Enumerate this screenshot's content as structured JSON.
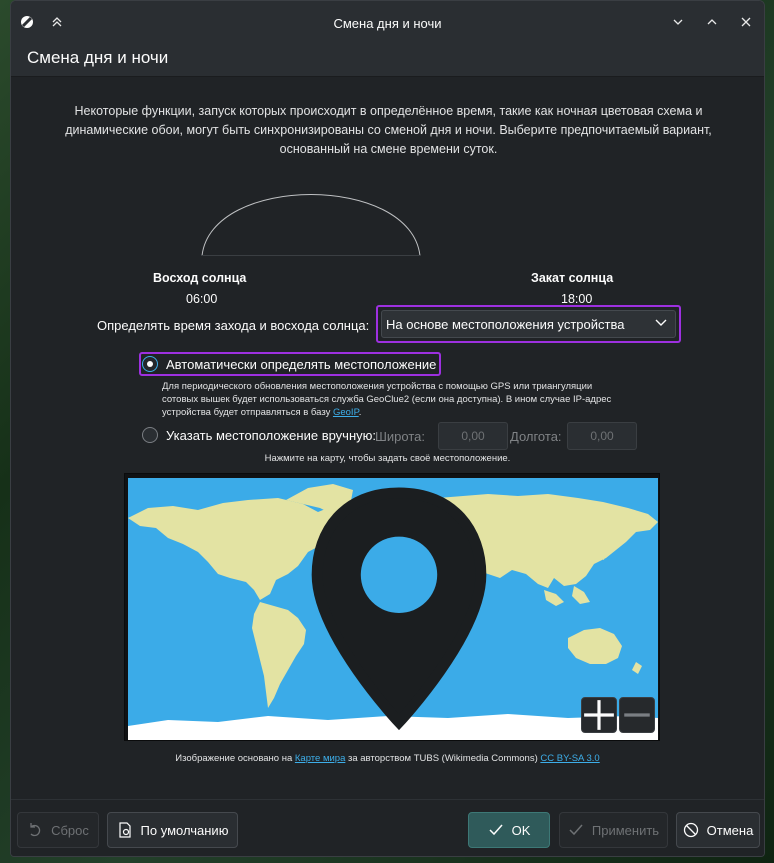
{
  "window": {
    "title": "Смена дня и ночи"
  },
  "header": {
    "title": "Смена дня и ночи"
  },
  "description": {
    "line1": "Некоторые функции, запуск которых происходит в определённое время, такие как ночная цветовая схема и",
    "line2": "динамические обои, могут быть синхронизированы со сменой дня и ночи. Выберите предпочитаемый вариант,",
    "line3": "основанный на смене времени суток."
  },
  "sunrise": {
    "label": "Восход солнца",
    "time": "06:00"
  },
  "sunset": {
    "label": "Закат солнца",
    "time": "18:00"
  },
  "mode": {
    "label": "Определять время захода и восхода солнца:",
    "selected": "На основе местоположения устройства"
  },
  "auto_location": {
    "label": "Автоматически определять местоположение",
    "checked": true,
    "help_line1": "Для периодического обновления местоположения устройства с помощью GPS или триангуляции",
    "help_line2": "сотовых вышек будет использоваться служба GeoClue2 (если она доступна). В ином случае IP-адрес",
    "help_line3_prefix": "устройства будет отправляться в базу ",
    "help_link": "GeoIP",
    "help_line3_suffix": "."
  },
  "manual_location": {
    "label": "Указать местоположение вручную:",
    "checked": false,
    "latitude_label": "Широта:",
    "latitude_value": "0,00",
    "longitude_label": "Долгота:",
    "longitude_value": "0,00"
  },
  "map_hint": "Нажмите на карту, чтобы задать своё местоположение.",
  "map": {
    "zoom_in": "+",
    "zoom_out": "−",
    "ocean_color": "#3babe8",
    "land_color": "#e3e3a3"
  },
  "attribution": {
    "prefix": "Изображение основано на ",
    "link1": "Карте мира",
    "middle": " за авторством TUBS (Wikimedia Commons) ",
    "link2": "CC BY-SA 3.0"
  },
  "footer": {
    "reset": "Сброс",
    "defaults": "По умолчанию",
    "ok": "OK",
    "apply": "Применить",
    "cancel": "Отмена"
  },
  "colors": {
    "accent": "#3daee9",
    "highlight": "#9d30e0",
    "window_bg": "#202326"
  }
}
